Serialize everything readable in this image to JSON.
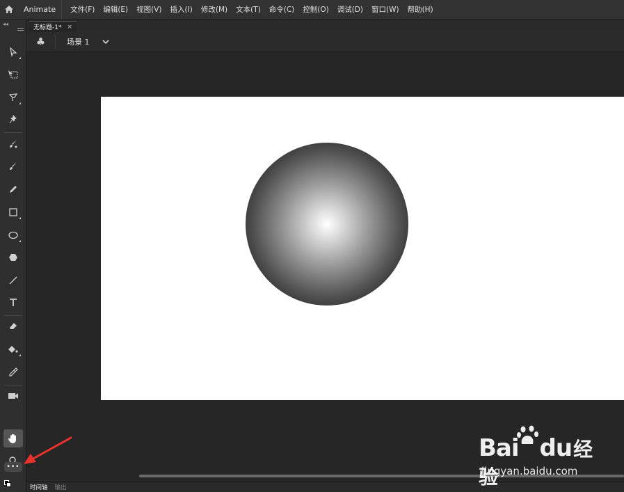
{
  "app": {
    "name": "Animate"
  },
  "menu": [
    "文件(F)",
    "编辑(E)",
    "视图(V)",
    "插入(I)",
    "修改(M)",
    "文本(T)",
    "命令(C)",
    "控制(O)",
    "调试(D)",
    "窗口(W)",
    "帮助(H)"
  ],
  "document": {
    "tab_title": "无标题-1*",
    "close_glyph": "×"
  },
  "editbar": {
    "scene_label": "场景 1"
  },
  "tools": [
    {
      "icon": "selection-icon"
    },
    {
      "icon": "free-transform-icon"
    },
    {
      "icon": "lasso-icon"
    },
    {
      "icon": "pin-icon"
    },
    {
      "icon": "fluid-brush-icon"
    },
    {
      "icon": "brush-icon"
    },
    {
      "icon": "pencil-icon"
    },
    {
      "icon": "rectangle-icon"
    },
    {
      "icon": "oval-icon"
    },
    {
      "icon": "polystar-icon"
    },
    {
      "icon": "line-icon"
    },
    {
      "icon": "text-icon"
    },
    {
      "icon": "eraser-icon"
    },
    {
      "icon": "paint-bucket-icon"
    },
    {
      "icon": "eyedropper-icon"
    },
    {
      "icon": "camera-icon"
    },
    {
      "icon": "hand-icon"
    },
    {
      "icon": "zoom-icon"
    }
  ],
  "more_tools_label": "•••",
  "bottom_tabs": [
    "时间轴",
    "输出"
  ],
  "watermark": {
    "brand_latin": "Bai",
    "brand_du": "du",
    "brand_cn": "经验",
    "url": "jingyan.baidu.com"
  },
  "colors": {
    "annotation_arrow": "#e8322d",
    "stage_background": "#ffffff"
  }
}
